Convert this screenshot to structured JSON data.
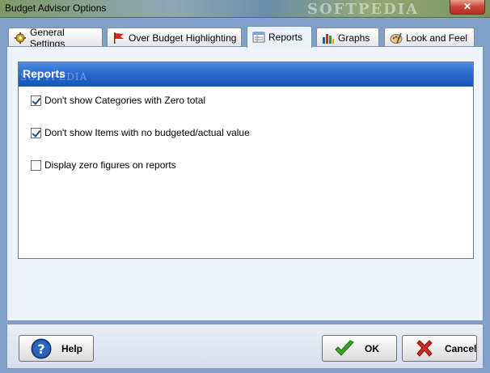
{
  "window": {
    "title": "Budget Advisor Options",
    "close_label": "✕",
    "watermark": "SOFTPEDIA"
  },
  "tabs": [
    {
      "label": "General Settings",
      "icon": "gear-icon"
    },
    {
      "label": "Over Budget Highlighting",
      "icon": "flag-icon"
    },
    {
      "label": "Reports",
      "icon": "report-icon"
    },
    {
      "label": "Graphs",
      "icon": "bar-chart-icon"
    },
    {
      "label": "Look and Feel",
      "icon": "palette-icon"
    }
  ],
  "active_tab": "Reports",
  "reports": {
    "header": "Reports",
    "watermark": "SOFTPEDIA",
    "options": [
      {
        "label": "Don't show Categories with Zero total",
        "checked": true
      },
      {
        "label": "Don't show Items with no budgeted/actual value",
        "checked": true
      },
      {
        "label": "Display zero figures on reports",
        "checked": false
      }
    ]
  },
  "buttons": {
    "help": "Help",
    "ok": "OK",
    "cancel": "Cancel"
  },
  "colors": {
    "header_blue": "#2a6bd0",
    "ok_green": "#3aa526",
    "cancel_red": "#d42a1e",
    "help_blue": "#1d4f9a"
  }
}
